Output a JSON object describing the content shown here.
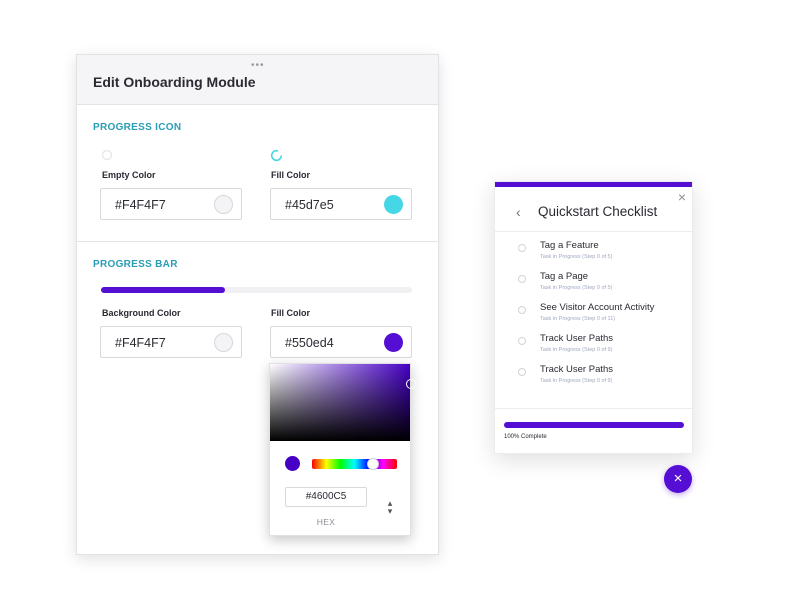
{
  "editor": {
    "title": "Edit Onboarding Module",
    "drag_handle": "•••",
    "progress_icon": {
      "section_title": "PROGRESS ICON",
      "empty_color": {
        "label": "Empty Color",
        "value": "#F4F4F7",
        "swatch": "#F4F4F7"
      },
      "fill_color": {
        "label": "Fill Color",
        "value": "#45d7e5",
        "swatch": "#45d7e5"
      }
    },
    "progress_bar": {
      "section_title": "PROGRESS BAR",
      "preview_fill": 0.4,
      "background_color": {
        "label": "Background Color",
        "value": "#F4F4F7",
        "swatch": "#F4F4F7"
      },
      "fill_color": {
        "label": "Fill Color",
        "value": "#550ed4",
        "swatch": "#550ed4"
      }
    }
  },
  "picker": {
    "hex_value": "#4600C5",
    "mode_label": "HEX",
    "mode_toggle": "▴▾",
    "current_color": "#4600C5"
  },
  "checklist": {
    "title": "Quickstart Checklist",
    "back_icon": "‹",
    "close_icon": "×",
    "tasks": [
      {
        "name": "Tag a Feature",
        "status": "Task in Progress (Step 0 of 5)"
      },
      {
        "name": "Tag a Page",
        "status": "Task in Progress (Step 0 of 5)"
      },
      {
        "name": "See Visitor Account Activity",
        "status": "Task in Progress (Step 0 of 11)"
      },
      {
        "name": "Track User Paths",
        "status": "Task in Progress (Step 0 of 9)"
      },
      {
        "name": "Track User Paths",
        "status": "Task in Progress (Step 0 of 9)"
      }
    ],
    "progress": 1.0,
    "complete_label": "100% Complete",
    "accent": "#550ed4"
  },
  "fab": {
    "icon": "×"
  }
}
